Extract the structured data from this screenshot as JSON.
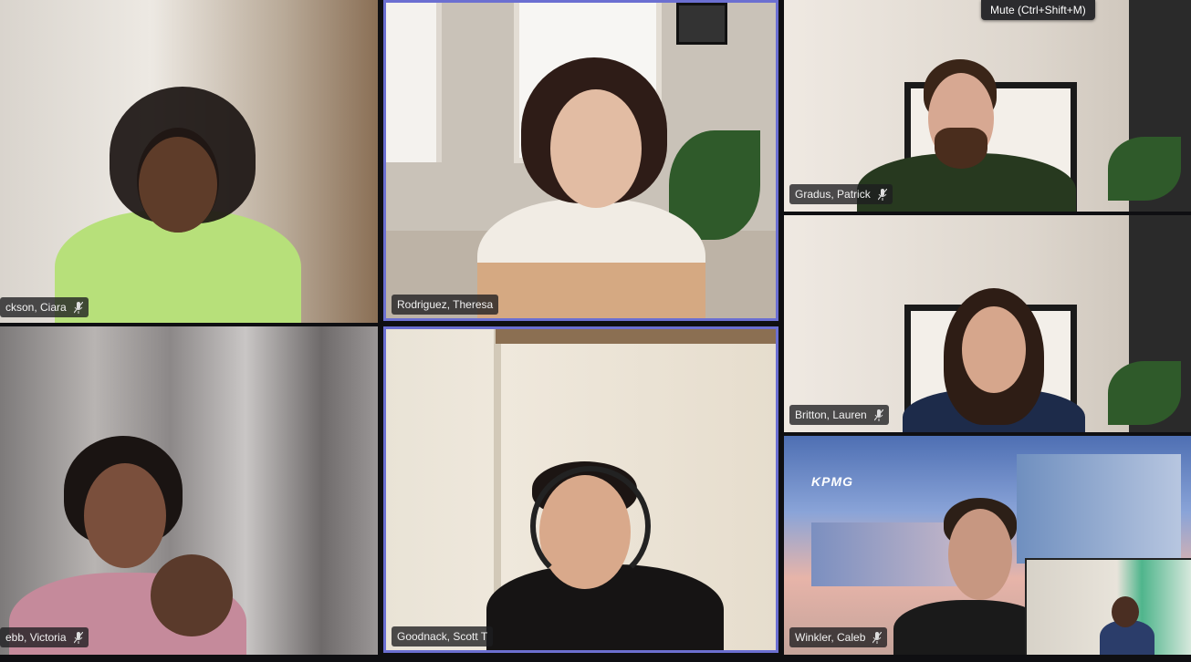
{
  "tooltip": {
    "mute": "Mute (Ctrl+Shift+M)"
  },
  "participants": [
    {
      "name": "ckson, Ciara",
      "muted": true
    },
    {
      "name": "Rodriguez, Theresa",
      "muted": false
    },
    {
      "name": "Gradus, Patrick",
      "muted": true
    },
    {
      "name": "Britton, Lauren",
      "muted": true
    },
    {
      "name": "ebb, Victoria",
      "muted": true
    },
    {
      "name": "Goodnack, Scott T",
      "muted": false
    },
    {
      "name": "Winkler, Caleb",
      "muted": true
    }
  ],
  "kpmg_logo": "KPMG",
  "colors": {
    "active_speaker_border": "#6b6fd1",
    "label_bg": "#1e1e20"
  }
}
